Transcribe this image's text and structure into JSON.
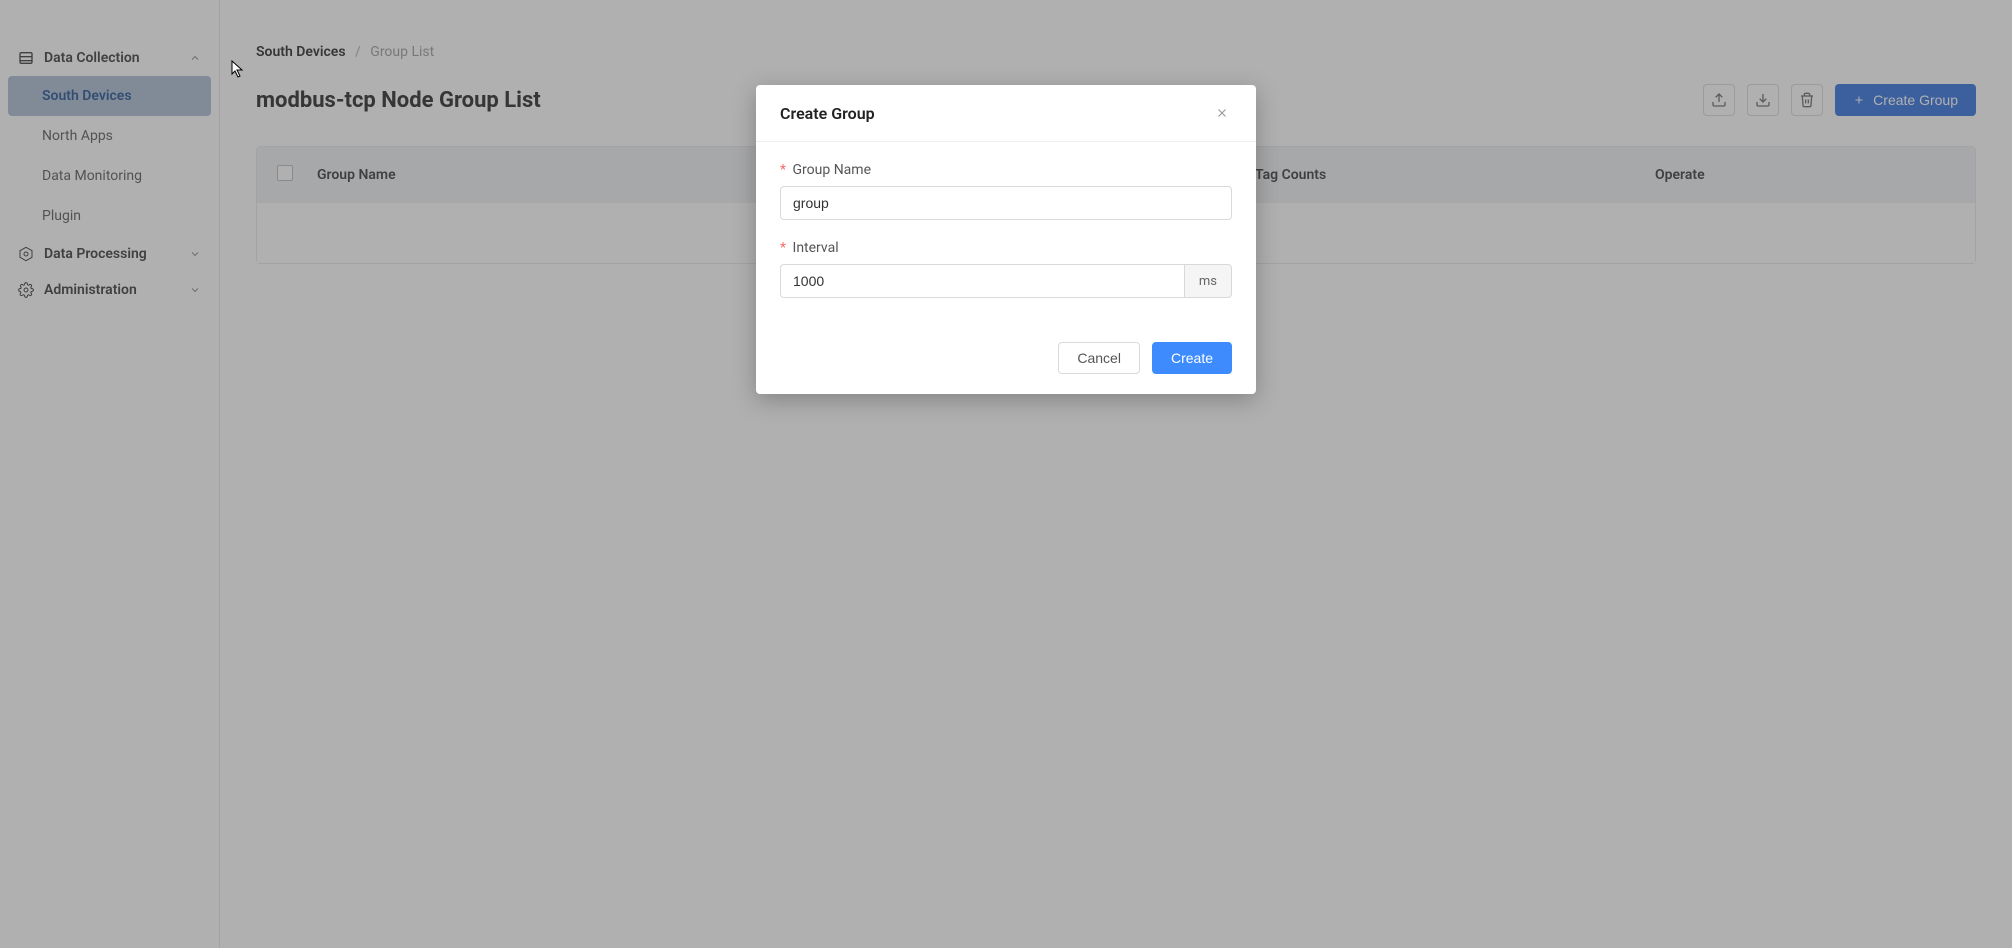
{
  "sidebar": {
    "groups": [
      {
        "label": "Data Collection",
        "expanded": true,
        "items": [
          {
            "label": "South Devices",
            "active": true
          },
          {
            "label": "North Apps",
            "active": false
          },
          {
            "label": "Data Monitoring",
            "active": false
          },
          {
            "label": "Plugin",
            "active": false
          }
        ]
      },
      {
        "label": "Data Processing",
        "expanded": false,
        "items": []
      },
      {
        "label": "Administration",
        "expanded": false,
        "items": []
      }
    ]
  },
  "breadcrumb": {
    "parent": "South Devices",
    "current": "Group List"
  },
  "page": {
    "title": "modbus-tcp Node Group List",
    "create_button_label": "Create Group"
  },
  "table": {
    "headers": {
      "name": "Group Name",
      "tags": "Tag Counts",
      "operate": "Operate"
    },
    "rows": []
  },
  "modal": {
    "title": "Create Group",
    "fields": {
      "group_name": {
        "label": "Group Name",
        "value": "group",
        "required": true
      },
      "interval": {
        "label": "Interval",
        "value": "1000",
        "unit": "ms",
        "required": true
      }
    },
    "buttons": {
      "cancel": "Cancel",
      "create": "Create"
    }
  },
  "colors": {
    "primary": "#2d6cdf",
    "primary_light": "#3d8bfd",
    "sidebar_active_bg": "#a9bcd4",
    "sidebar_active_fg": "#1d4c8f"
  }
}
